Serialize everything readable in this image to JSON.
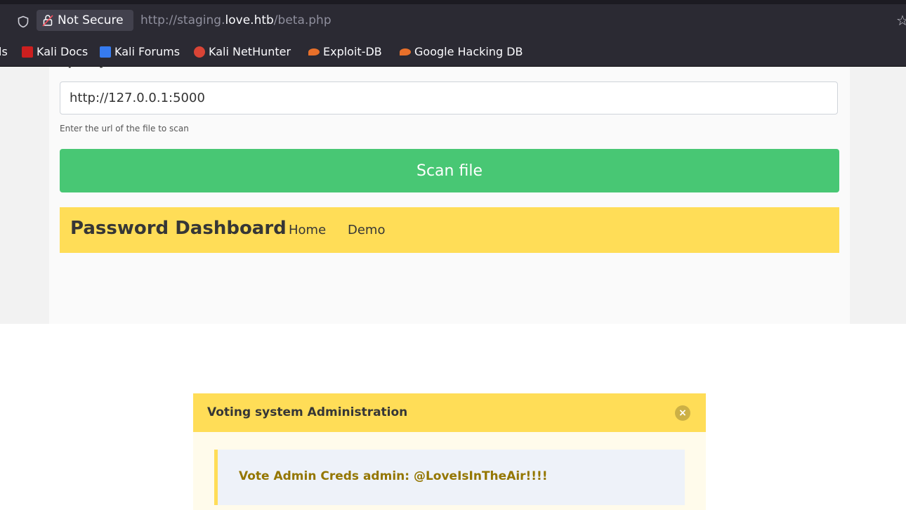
{
  "browser": {
    "security_label": "Not Secure",
    "url_prefix": "http://staging.",
    "url_host": "love.htb",
    "url_path": "/beta.php",
    "bookmarks": [
      {
        "label": "ls"
      },
      {
        "label": "Kali Docs",
        "icon": "kali-docs-icon",
        "color": "#cc1f1f"
      },
      {
        "label": "Kali Forums",
        "icon": "kali-forums-icon",
        "color": "#367bf0"
      },
      {
        "label": "Kali NetHunter",
        "icon": "kali-nethunter-icon",
        "color": "#d94436"
      },
      {
        "label": "Exploit-DB",
        "icon": "exploit-db-icon",
        "color": "#e8702a"
      },
      {
        "label": "Google Hacking DB",
        "icon": "ghdb-icon",
        "color": "#e8702a"
      }
    ]
  },
  "form": {
    "cut_label": "Specify the file url:",
    "url_value": "http://127.0.0.1:5000",
    "help_text": "Enter the url of the file to scan",
    "scan_button": "Scan file"
  },
  "navbar": {
    "brand": "Password Dashboard",
    "items": [
      "Home",
      "Demo"
    ],
    "color": "#ffdd57"
  },
  "notification": {
    "title": "Voting system Administration",
    "message": "Vote Admin Creds admin: @LoveIsInTheAir!!!!",
    "close_glyph": "×"
  },
  "colors": {
    "scan_button": "#48c774",
    "warning": "#ffdd57",
    "warning_text": "#947600"
  }
}
